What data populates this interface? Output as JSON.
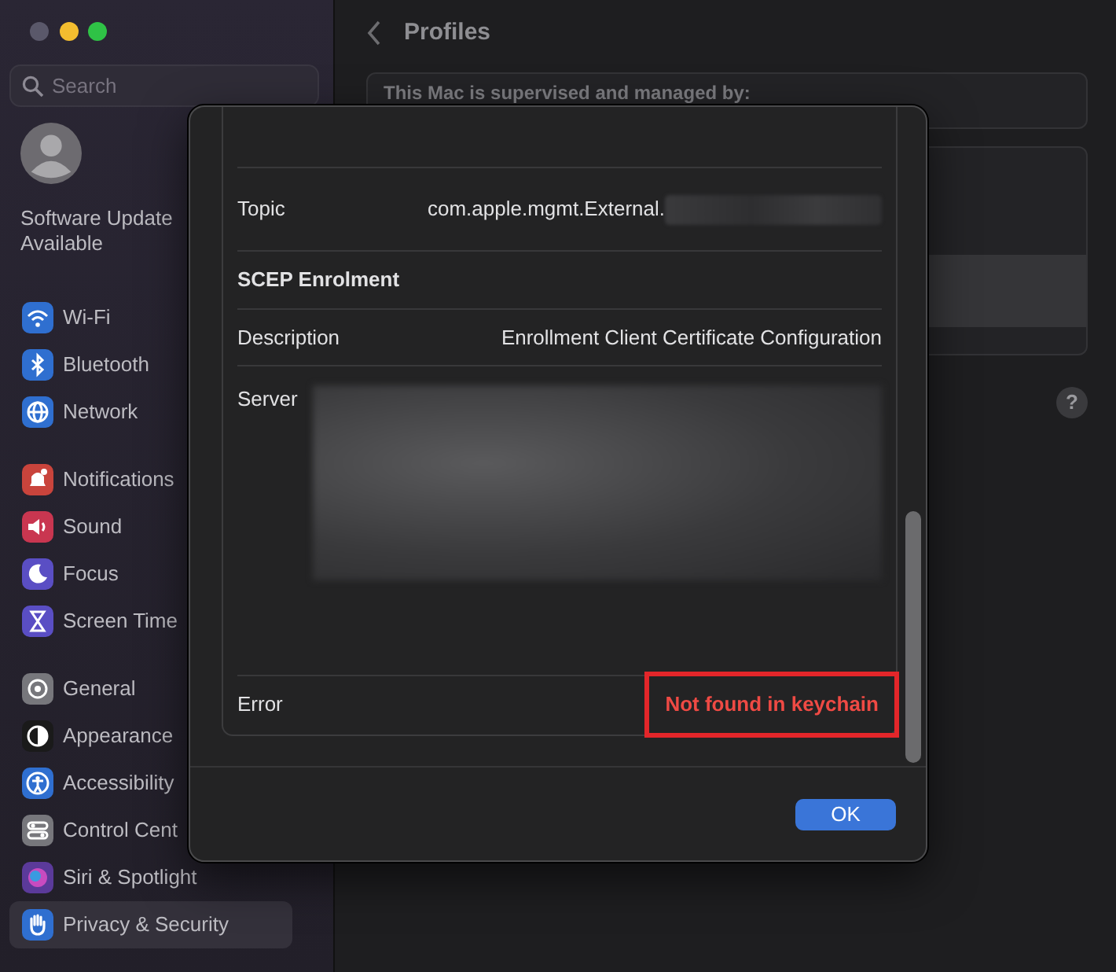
{
  "sidebar": {
    "search": {
      "placeholder": "Search"
    },
    "account": {
      "label": "Software Update Available"
    },
    "groups": [
      [
        {
          "label": "Wi-Fi",
          "color": "#2f6fd0",
          "selected": false
        },
        {
          "label": "Bluetooth",
          "color": "#2f6fd0",
          "selected": false
        },
        {
          "label": "Network",
          "color": "#2f6fd0",
          "selected": false
        }
      ],
      [
        {
          "label": "Notifications",
          "color": "#c9443c",
          "selected": false
        },
        {
          "label": "Sound",
          "color": "#c93650",
          "selected": false
        },
        {
          "label": "Focus",
          "color": "#5a4ec4",
          "selected": false
        },
        {
          "label": "Screen Time",
          "color": "#5a4ec4",
          "selected": false
        }
      ],
      [
        {
          "label": "General",
          "color": "#77777c",
          "selected": false
        },
        {
          "label": "Appearance",
          "color": "#1a1a1a",
          "selected": false
        },
        {
          "label": "Accessibility",
          "color": "#2f6fd0",
          "selected": false
        },
        {
          "label": "Control Cent",
          "color": "#77777c",
          "selected": false
        },
        {
          "label": "Siri & Spotlight",
          "color": "#5b3a9a",
          "selected": false
        },
        {
          "label": "Privacy & Security",
          "color": "#2f6fd0",
          "selected": true
        }
      ]
    ]
  },
  "header": {
    "title": "Profiles"
  },
  "notice": "This Mac is supervised and managed by:",
  "profile_rows": [
    {
      "selected": false
    },
    {
      "selected": true
    }
  ],
  "help_button": "?",
  "dialog": {
    "rows": [
      {
        "kind": "field",
        "label": "Topic",
        "value": "com.apple.mgmt.External.",
        "redacted": true
      },
      {
        "kind": "section",
        "label": "SCEP Enrolment"
      },
      {
        "kind": "field",
        "label": "Description",
        "value": "Enrollment Client Certificate Configuration",
        "redacted": false
      },
      {
        "kind": "blurred",
        "label": "Server"
      },
      {
        "kind": "field",
        "label": "Error",
        "value": "Not found in keychain",
        "redacted": false,
        "error": true,
        "highlighted": true
      }
    ],
    "buttons": [
      {
        "label": "OK",
        "default": true
      }
    ]
  }
}
